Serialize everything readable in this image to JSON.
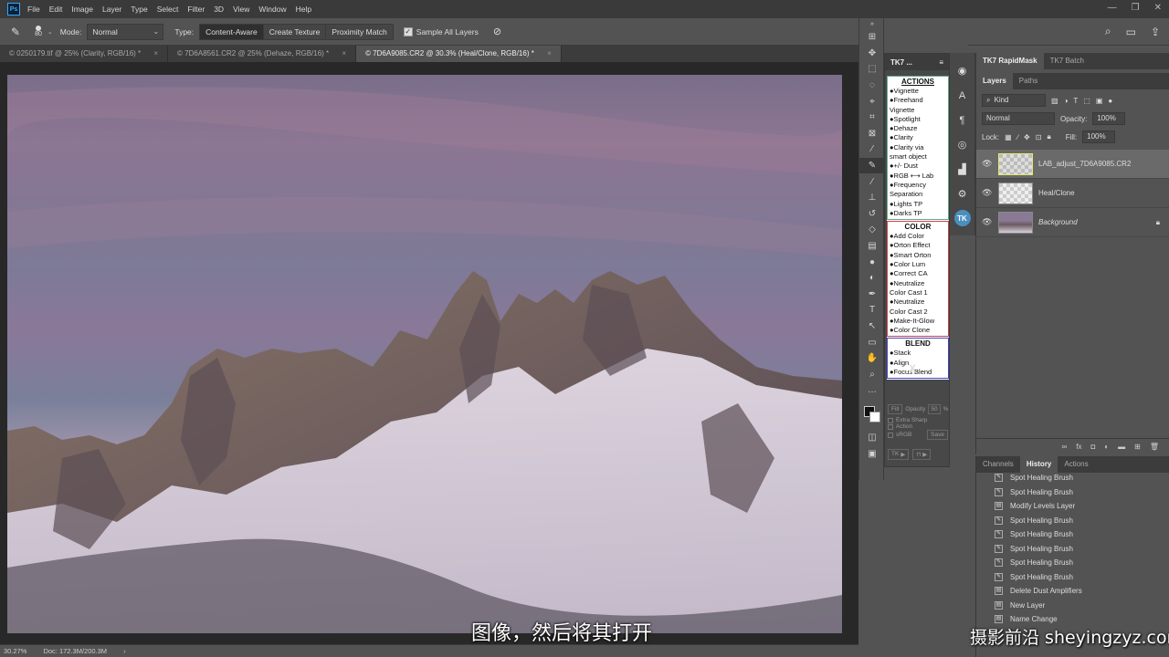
{
  "menu": [
    "File",
    "Edit",
    "Image",
    "Layer",
    "Type",
    "Select",
    "Filter",
    "3D",
    "View",
    "Window",
    "Help"
  ],
  "options": {
    "brush_size": "80",
    "mode_label": "Mode:",
    "mode_value": "Normal",
    "type_label": "Type:",
    "type_buttons": [
      "Content-Aware",
      "Create Texture",
      "Proximity Match"
    ],
    "sample_all": "Sample All Layers"
  },
  "tabs": [
    {
      "label": "© 0250179.tif @ 25% (Clarity, RGB/16) *"
    },
    {
      "label": "© 7D6A8561.CR2 @ 25% (Dehaze, RGB/16) *"
    },
    {
      "label": "© 7D6A9085.CR2 @ 30.3% (Heal/Clone, RGB/16) *"
    }
  ],
  "status": {
    "zoom": "30.27%",
    "doc": "Doc: 172.3M/200.3M"
  },
  "tk_panel": {
    "title": "TK7 ...",
    "sections": [
      {
        "heading": "ACTIONS",
        "items": [
          "●Vignette",
          "●Freehand",
          "  Vignette",
          "●Spotlight",
          "●Dehaze",
          "●Clarity",
          "●Clarity via",
          "  smart object",
          "●+/- Dust",
          "●RGB ⟷ Lab",
          "●Frequency",
          "  Separation",
          "●Lights TP",
          "●Darks TP"
        ]
      },
      {
        "heading": "COLOR",
        "items": [
          "●Add Color",
          "●Orton Effect",
          "●Smart Orton",
          "●Color Lum",
          "●Correct CA",
          "●Neutralize",
          "  Color Cast 1",
          "●Neutralize",
          "  Color Cast 2",
          "●Make-It-Glow",
          "●Color Clone"
        ]
      },
      {
        "heading": "BLEND",
        "items": [
          "●Stack",
          "●Align",
          "●Focus Blend"
        ]
      }
    ],
    "close": "X",
    "fill": "Fill",
    "opacity": "Opacity",
    "opacity_value": "50",
    "pct": "%",
    "extra_sharp": "Extra Sharp",
    "action": "Action",
    "srgb": "sRGB",
    "save": "Save",
    "tk_btn": "TK"
  },
  "layers_panel": {
    "tabs_top": [
      "TK7 RapidMask",
      "TK7 Batch"
    ],
    "tabs": [
      "Layers",
      "Paths"
    ],
    "kind": "Kind",
    "blend": "Normal",
    "opacity_label": "Opacity:",
    "opacity": "100%",
    "lock_label": "Lock:",
    "fill_label": "Fill:",
    "fill": "100%",
    "layers": [
      {
        "name": "LAB_adjust_7D6A9085.CR2",
        "selected": true
      },
      {
        "name": "Heal/Clone",
        "selected": false
      },
      {
        "name": "Background",
        "selected": false
      }
    ]
  },
  "history_panel": {
    "tabs": [
      "Channels",
      "History",
      "Actions"
    ],
    "items": [
      "Spot Healing Brush",
      "Spot Healing Brush",
      "Modify Levels Layer",
      "Spot Healing Brush",
      "Spot Healing Brush",
      "Spot Healing Brush",
      "Spot Healing Brush",
      "Spot Healing Brush",
      "Delete Dust Amplifiers",
      "New Layer",
      "Name Change"
    ]
  },
  "subtitle": "图像，然后将其打开",
  "watermark": "摄影前沿 sheyingzyz.com"
}
